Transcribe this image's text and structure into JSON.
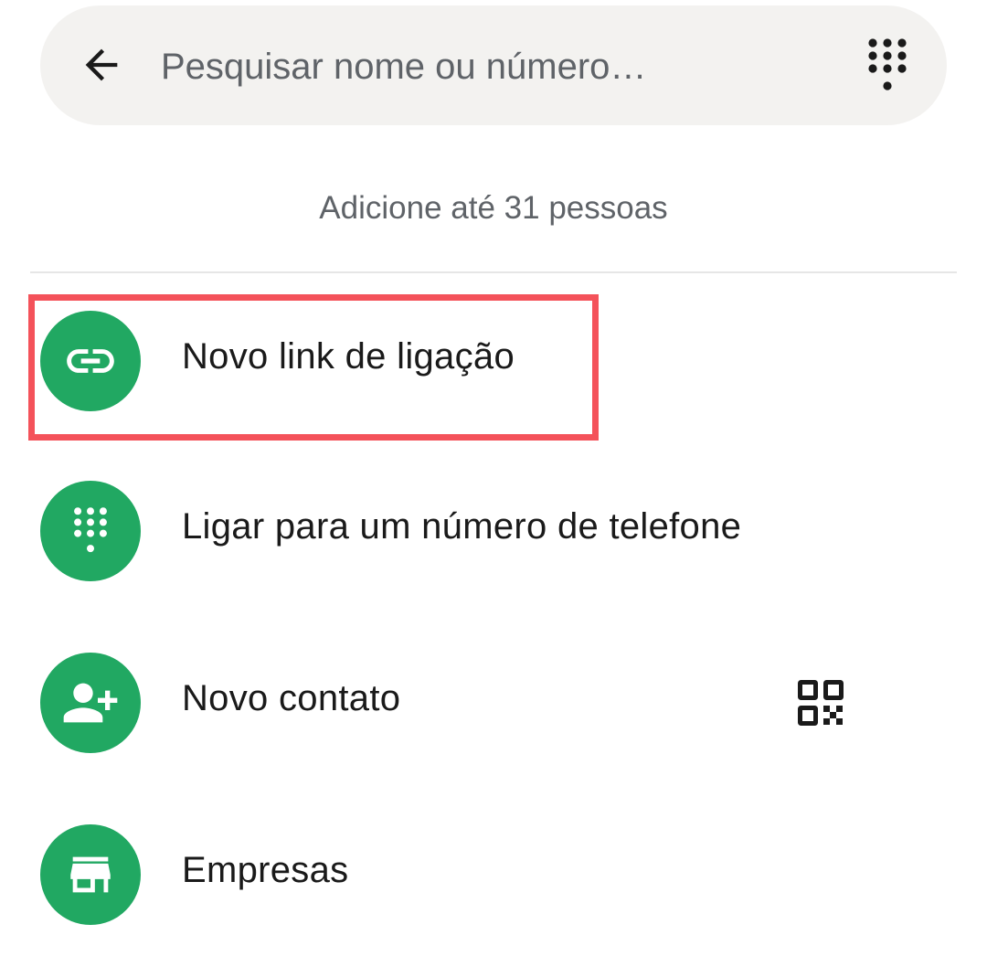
{
  "search": {
    "placeholder": "Pesquisar nome ou número…",
    "value": ""
  },
  "hint": "Adicione até 31 pessoas",
  "actions": [
    {
      "label": "Novo link de ligação",
      "icon": "link-icon"
    },
    {
      "label": "Ligar para um número de telefone",
      "icon": "dialpad-icon"
    },
    {
      "label": "Novo contato",
      "icon": "person-add-icon",
      "extra_icon": "qr-code-icon"
    },
    {
      "label": "Empresas",
      "icon": "storefront-icon"
    }
  ],
  "colors": {
    "accent_green": "#21a862",
    "highlight_red": "#f4525a",
    "search_background": "#f3f2f0",
    "muted_text": "#5f6368"
  }
}
